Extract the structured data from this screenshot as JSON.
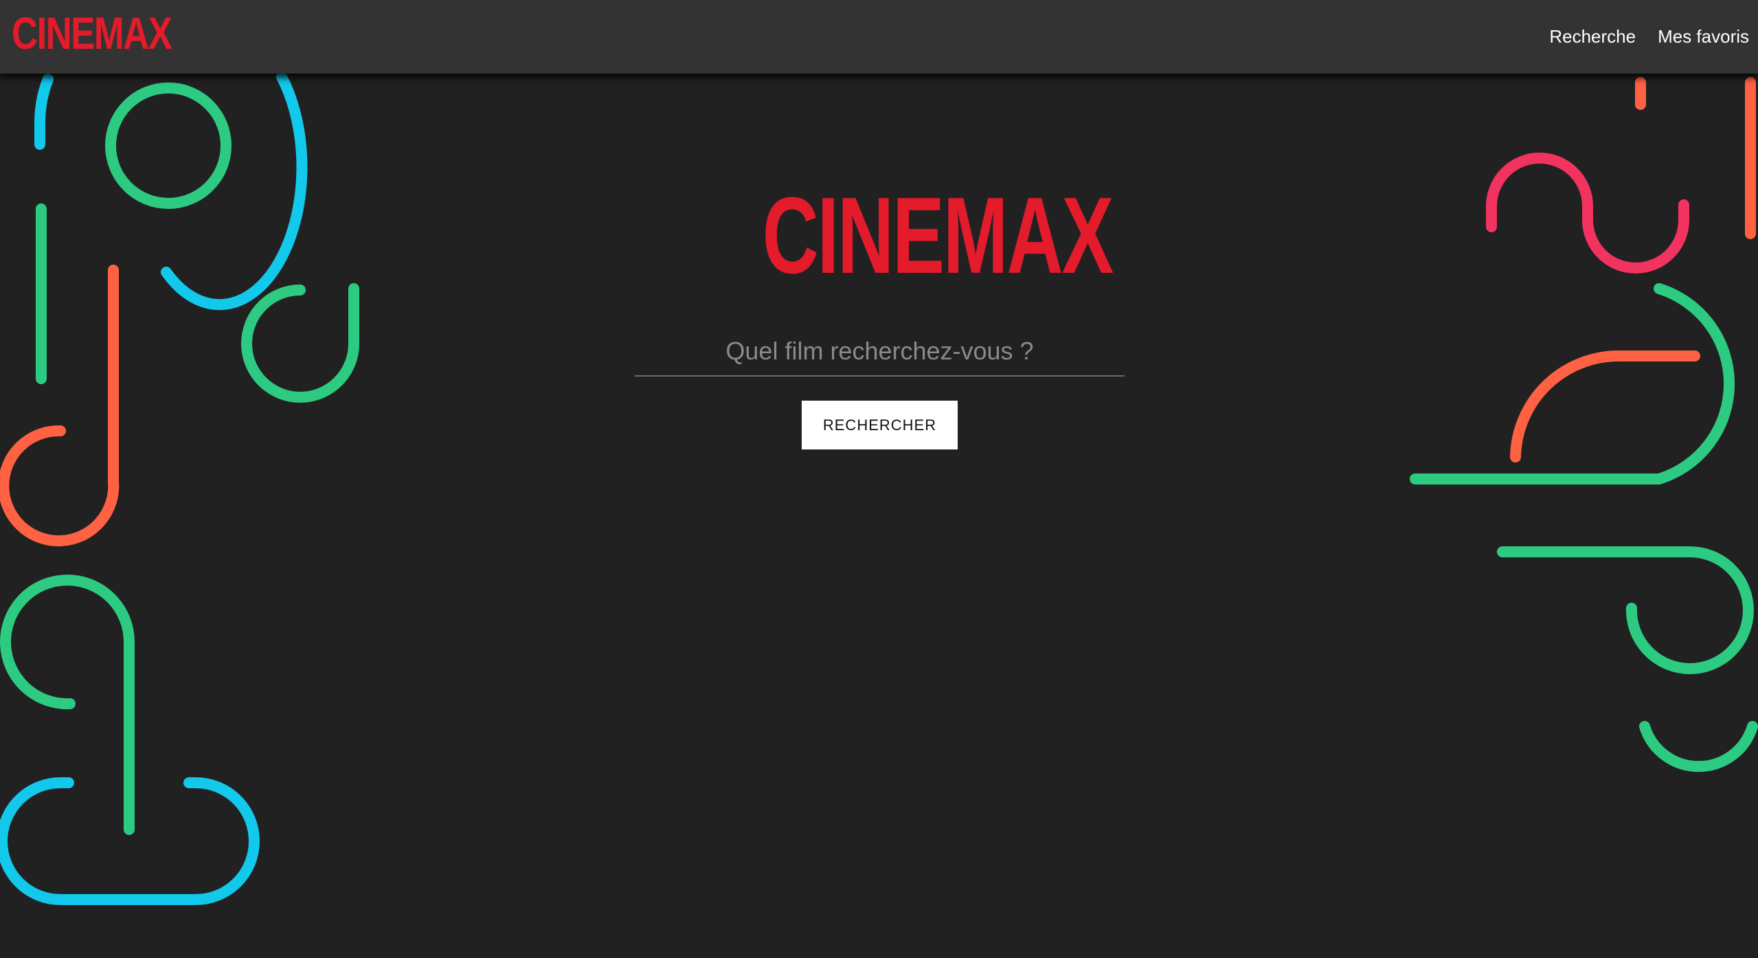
{
  "app": {
    "brand": "CINEMAX"
  },
  "navbar": {
    "logo_text": "CINEMAX",
    "links": [
      {
        "label": "Recherche"
      },
      {
        "label": "Mes favoris"
      }
    ]
  },
  "hero": {
    "logo_text": "CINEMAX"
  },
  "search": {
    "placeholder": "Quel film recherchez-vous ?",
    "value": "",
    "button_label": "RECHERCHER"
  },
  "colors": {
    "background": "#212121",
    "navbar": "#333333",
    "brand_red": "#e31b2b",
    "decor_green": "#2dcb82",
    "decor_blue": "#12c9ec",
    "decor_orange": "#ff6242",
    "decor_pink": "#f2335f"
  }
}
